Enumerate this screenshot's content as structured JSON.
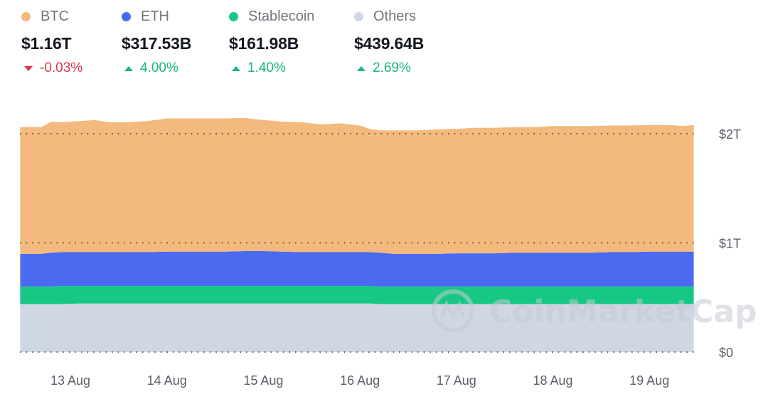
{
  "legend": [
    {
      "name": "BTC",
      "value": "$1.16T",
      "change": "-0.03%",
      "direction": "down",
      "color": "#f3b97d"
    },
    {
      "name": "ETH",
      "value": "$317.53B",
      "change": "4.00%",
      "direction": "up",
      "color": "#4a6bf0"
    },
    {
      "name": "Stablecoin",
      "value": "$161.98B",
      "change": "1.40%",
      "direction": "up",
      "color": "#17c784"
    },
    {
      "name": "Others",
      "value": "$439.64B",
      "change": "2.69%",
      "direction": "up",
      "color": "#cfd6e4"
    }
  ],
  "watermark": "CoinMarketCap",
  "chart_data": {
    "type": "area",
    "stacked": true,
    "title": "",
    "xlabel": "",
    "ylabel": "",
    "x_unit": "days (0 = 13 Aug 00:00)",
    "x": [
      -0.52,
      -0.3,
      -0.2,
      -0.1,
      0.1,
      0.25,
      0.4,
      0.6,
      0.8,
      1.0,
      1.2,
      1.4,
      1.6,
      1.8,
      2.0,
      2.2,
      2.4,
      2.6,
      2.8,
      3.0,
      3.1,
      3.2,
      3.35,
      3.6,
      3.8,
      4.0,
      4.2,
      4.4,
      4.6,
      4.8,
      5.0,
      5.2,
      5.4,
      5.6,
      5.8,
      6.0,
      6.2,
      6.35,
      6.46
    ],
    "series": [
      {
        "name": "Others",
        "values": [
          0.44,
          0.44,
          0.44,
          0.44,
          0.445,
          0.445,
          0.445,
          0.445,
          0.445,
          0.445,
          0.445,
          0.445,
          0.445,
          0.445,
          0.445,
          0.445,
          0.445,
          0.445,
          0.445,
          0.445,
          0.445,
          0.44,
          0.44,
          0.44,
          0.44,
          0.44,
          0.44,
          0.44,
          0.44,
          0.44,
          0.44,
          0.44,
          0.44,
          0.44,
          0.44,
          0.44,
          0.44,
          0.44,
          0.44
        ]
      },
      {
        "name": "Stablecoin",
        "values": [
          0.16,
          0.16,
          0.16,
          0.165,
          0.16,
          0.16,
          0.16,
          0.16,
          0.16,
          0.16,
          0.16,
          0.16,
          0.16,
          0.16,
          0.16,
          0.16,
          0.16,
          0.16,
          0.16,
          0.16,
          0.16,
          0.16,
          0.16,
          0.16,
          0.16,
          0.16,
          0.16,
          0.16,
          0.16,
          0.16,
          0.16,
          0.16,
          0.16,
          0.16,
          0.16,
          0.16,
          0.16,
          0.16,
          0.16
        ]
      },
      {
        "name": "ETH",
        "values": [
          0.3,
          0.3,
          0.31,
          0.31,
          0.31,
          0.31,
          0.31,
          0.31,
          0.31,
          0.315,
          0.315,
          0.315,
          0.315,
          0.32,
          0.32,
          0.315,
          0.31,
          0.31,
          0.31,
          0.31,
          0.31,
          0.31,
          0.3,
          0.3,
          0.3,
          0.305,
          0.305,
          0.305,
          0.31,
          0.31,
          0.31,
          0.31,
          0.31,
          0.315,
          0.315,
          0.32,
          0.32,
          0.32,
          0.32
        ]
      },
      {
        "name": "BTC",
        "values": [
          1.16,
          1.16,
          1.2,
          1.19,
          1.2,
          1.21,
          1.19,
          1.19,
          1.2,
          1.22,
          1.22,
          1.22,
          1.22,
          1.22,
          1.2,
          1.19,
          1.19,
          1.17,
          1.18,
          1.16,
          1.13,
          1.12,
          1.13,
          1.13,
          1.14,
          1.14,
          1.15,
          1.15,
          1.15,
          1.15,
          1.16,
          1.16,
          1.16,
          1.16,
          1.16,
          1.16,
          1.16,
          1.15,
          1.16
        ]
      }
    ],
    "x_ticks": [
      "13 Aug",
      "14 Aug",
      "15 Aug",
      "16 Aug",
      "17 Aug",
      "18 Aug",
      "19 Aug"
    ],
    "x_tick_positions": [
      0,
      1,
      2,
      3,
      4,
      5,
      6
    ],
    "y_ticks": [
      "$0",
      "$1T",
      "$2T"
    ],
    "y_tick_values": [
      0,
      1,
      2
    ],
    "ylim": [
      0,
      2.2
    ],
    "y_unit": "trillion USD",
    "grid": "horizontal dotted",
    "legend_position": "top"
  }
}
